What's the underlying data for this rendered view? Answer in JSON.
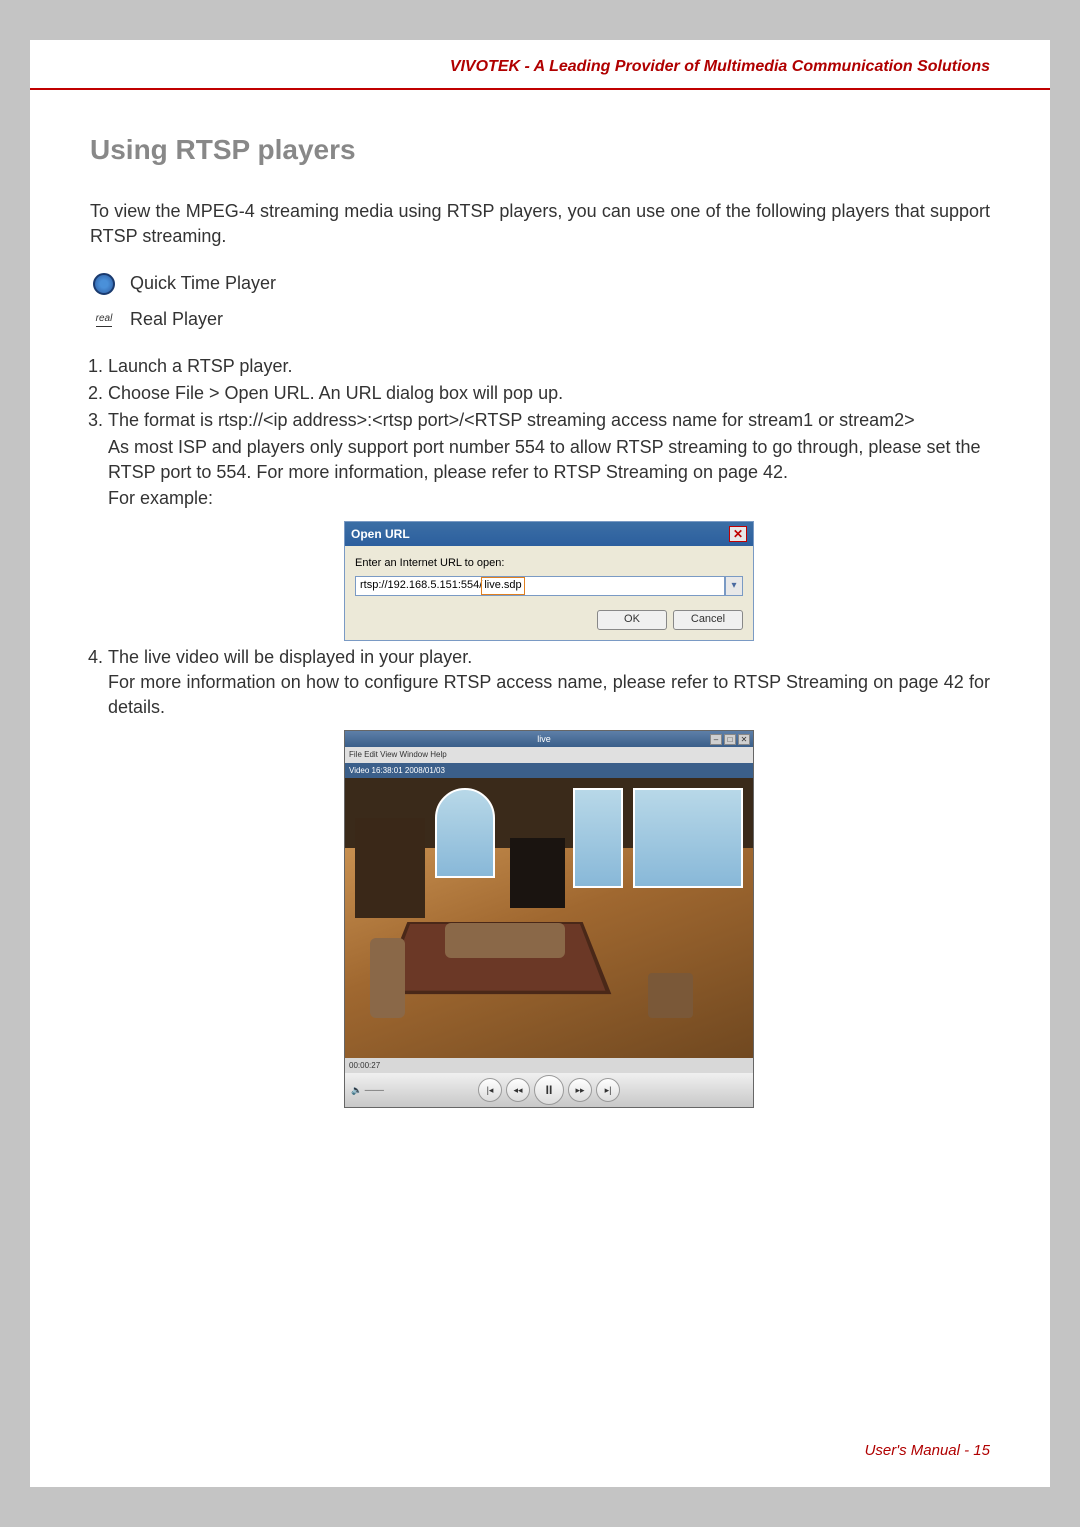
{
  "header": {
    "title": "VIVOTEK - A Leading Provider of Multimedia Communication Solutions"
  },
  "section": {
    "heading": "Using RTSP players",
    "intro": "To view the MPEG-4 streaming media using RTSP players, you can use one of the following players that support RTSP streaming.",
    "players": {
      "quicktime": "Quick Time Player",
      "real": "Real Player"
    },
    "steps": {
      "s1": "Launch a RTSP player.",
      "s2": "Choose File > Open URL. An URL dialog box will pop up.",
      "s3": "The format is rtsp://<ip address>:<rtsp port>/<RTSP streaming access name for stream1 or stream2>",
      "s3_note": "As most ISP and players only support port number 554 to allow RTSP streaming to go through, please set the RTSP port to 554. For more information, please refer to RTSP Streaming on page 42.",
      "s3_example": "For example:",
      "s4": "The live video will be displayed in your player.",
      "s4_note": "For more information on how to configure RTSP access name, please refer to RTSP Streaming on page 42 for details."
    }
  },
  "dialog": {
    "title": "Open URL",
    "label": "Enter an Internet URL to open:",
    "url_base": "rtsp://192.168.5.151:554/",
    "url_hl": "live.sdp",
    "ok": "OK",
    "cancel": "Cancel"
  },
  "player": {
    "title": "live",
    "menu": "File  Edit  View  Window  Help",
    "overlay": "Video 16:38:01 2008/01/03",
    "time": "00:00:27"
  },
  "footer": {
    "text": "User's Manual - 15"
  }
}
